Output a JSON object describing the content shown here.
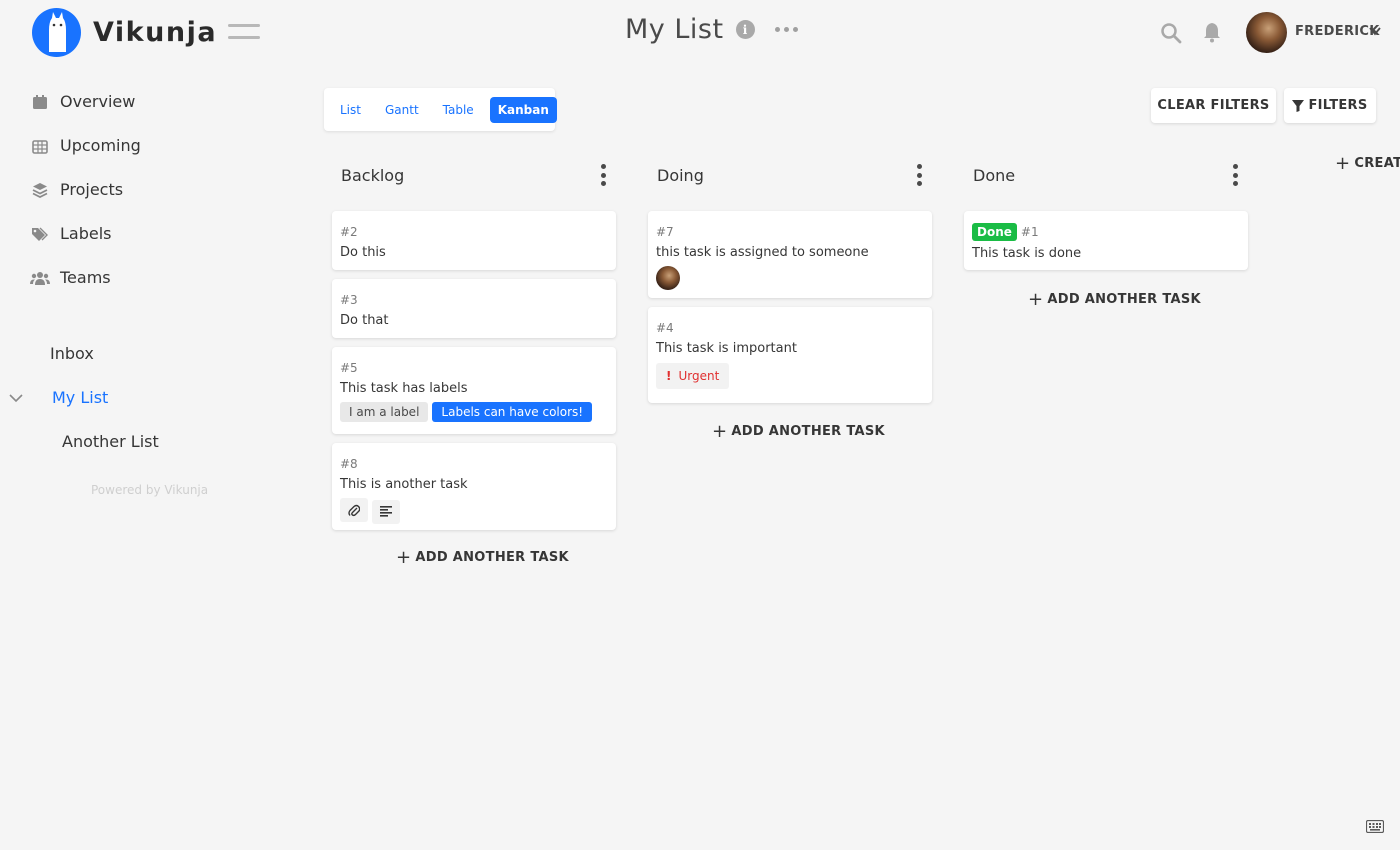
{
  "app": {
    "name": "Vikunja"
  },
  "header": {
    "title": "My List",
    "username": "FREDERICK"
  },
  "sidebar": {
    "nav": [
      {
        "label": "Overview",
        "icon": "calendar-icon"
      },
      {
        "label": "Upcoming",
        "icon": "calendar-grid-icon"
      },
      {
        "label": "Projects",
        "icon": "layers-icon"
      },
      {
        "label": "Labels",
        "icon": "tags-icon"
      },
      {
        "label": "Teams",
        "icon": "users-icon"
      }
    ],
    "lists": [
      {
        "label": "Inbox"
      },
      {
        "label": "My List",
        "active": true
      },
      {
        "label": "Another List"
      }
    ],
    "powered_by": "Powered by Vikunja"
  },
  "views": [
    "List",
    "Gantt",
    "Table",
    "Kanban"
  ],
  "active_view": "Kanban",
  "toolbar": {
    "clear_filters": "CLEAR FILTERS",
    "filters": "FILTERS",
    "create_bucket": "CREATE"
  },
  "add_task_label": "ADD ANOTHER TASK",
  "buckets": [
    {
      "title": "Backlog",
      "tasks": [
        {
          "id": "#2",
          "title": "Do this"
        },
        {
          "id": "#3",
          "title": "Do that"
        },
        {
          "id": "#5",
          "title": "This task has labels",
          "labels": [
            {
              "text": "I am a label",
              "bg": "#e8e8e8",
              "fg": "#4a4a4a"
            },
            {
              "text": "Labels can have colors!",
              "bg": "#1973ff",
              "fg": "#ffffff"
            }
          ]
        },
        {
          "id": "#8",
          "title": "This is another task"
        }
      ]
    },
    {
      "title": "Doing",
      "tasks": [
        {
          "id": "#7",
          "title": "this task is assigned to someone"
        },
        {
          "id": "#4",
          "title": "This task is important",
          "priority": "Urgent"
        }
      ]
    },
    {
      "title": "Done",
      "tasks": [
        {
          "id": "#1",
          "title": "This task is done",
          "badge": "Done"
        }
      ]
    }
  ],
  "colors": {
    "accent": "#1973ff",
    "done": "#1abc45",
    "urgent": "#e03030"
  }
}
